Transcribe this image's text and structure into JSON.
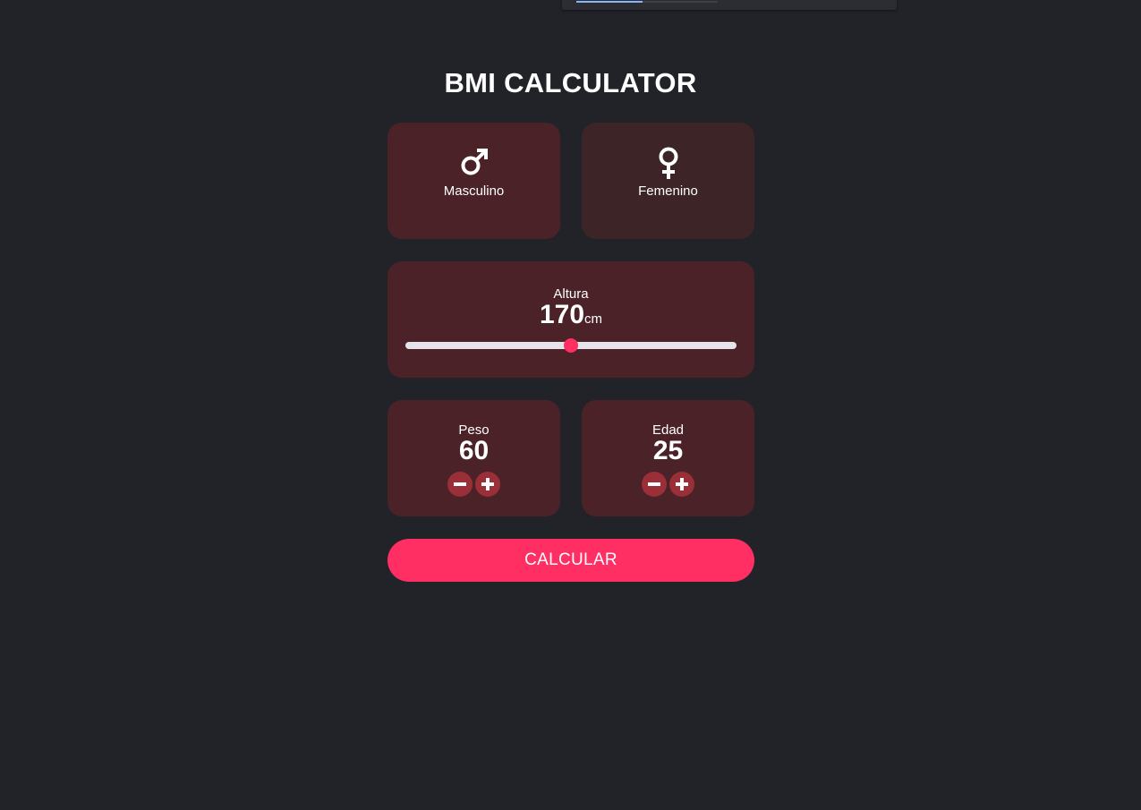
{
  "app": {
    "title": "BMI CALCULATOR"
  },
  "browser_overlay": {
    "progress": 0.47
  },
  "gender": {
    "male_label": "Masculino",
    "female_label": "Femenino",
    "male_icon": "male-symbol-icon",
    "female_icon": "female-symbol-icon",
    "selected": "male"
  },
  "height": {
    "label": "Altura",
    "value": "170",
    "unit": "cm",
    "slider_fraction": 0.5
  },
  "weight": {
    "label": "Peso",
    "value": "60"
  },
  "age": {
    "label": "Edad",
    "value": "25"
  },
  "actions": {
    "calculate_label": "CALCULAR"
  },
  "colors": {
    "background": "#212329",
    "card_active": "#4a2227",
    "card_inactive": "#3c2427",
    "accent": "#ff2e63",
    "stepper_button": "#9b2f37"
  }
}
